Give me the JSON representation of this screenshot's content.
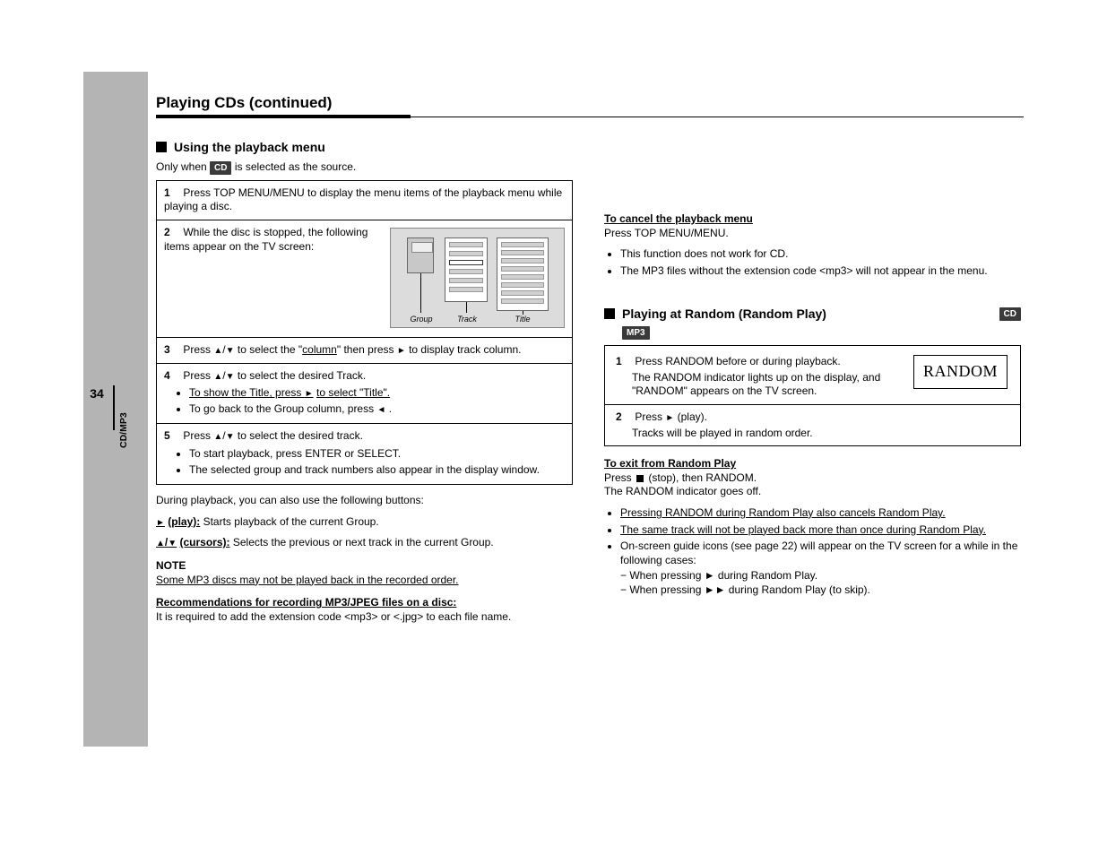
{
  "page_number": "34",
  "section_label": "CD/MP3",
  "chapter_title": "Playing CDs (continued)",
  "left": {
    "heading": "Using the playback menu",
    "badge": "CD",
    "intro_before_badge": "Only when ",
    "intro_after_badge": " is selected as the source.",
    "table": {
      "row1": {
        "text": "Press TOP MENU/MENU to display the menu items of the playback menu while playing a disc."
      },
      "row2": {
        "text_before": "While the disc is stopped, the following items appear on the TV screen:",
        "diagram": {
          "a": "Group",
          "b": "Track",
          "c": "Title"
        }
      },
      "row3": {
        "prefix": "Press ",
        "mid1": " to select the \"",
        "col_phrase": "column",
        "mid2": "\" then press ",
        "suffix": " to display track column."
      },
      "row4": {
        "prefix": "Press ",
        "mid": " to select the desired Track.",
        "b1_prefix": "To show the Title, press ",
        "b1_suffix": " to select \"Title\".",
        "b2_prefix": "To go back to the Group column, press ",
        "b2_suffix": "."
      },
      "row5": {
        "prefix": "Press ",
        "mid": " to select the desired track.",
        "b1": "To start playback, press ENTER or SELECT.",
        "b2": "The selected group and track numbers also appear in the display window."
      }
    },
    "after": {
      "line1": "During playback, you can also use the following buttons:",
      "h1_before": "",
      "h1_after": " (play):",
      "h1_body": "Starts playback of the current Group.",
      "h2_before": "",
      "h2_after": " (cursors):",
      "h2_body": "Selects the previous or next track in the current Group.",
      "note_head": "NOTE",
      "note_line_before": "Some MP3 discs may not be played back in the recorded order.",
      "lim_head": "Recommendations for recording MP3/JPEG files on a disc:",
      "lim_body": "It is required to add the extension code <mp3> or <.jpg> to each file name."
    }
  },
  "right": {
    "cancel_head": "To cancel the playback menu",
    "cancel_body": "Press TOP MENU/MENU.",
    "b1": "This function does not work for CD.",
    "b2": "The MP3 files without the extension code <mp3> will not appear in the menu.",
    "heading": "Playing at Random (Random Play)",
    "badge1": "CD",
    "badge2": "MP3",
    "random": {
      "row1_prefix": "Press RANDOM before or during playback.",
      "row1_body": "The RANDOM indicator lights up on the display, and \"RANDOM\" appears on the TV screen.",
      "display": "RANDOM",
      "row2_prefix": "Press ",
      "row2_suffix": " (play).",
      "row2_body": "Tracks will be played in random order."
    },
    "exit_head": "To exit from Random Play",
    "exit_body_before": "Press ",
    "exit_body_after": " (stop), then RANDOM.",
    "exit_body2": "The RANDOM indicator goes off.",
    "b_a": "Pressing RANDOM during Random Play also cancels Random Play.",
    "b_b": "The same track will not be played back more than once during Random Play.",
    "b_c": "On-screen guide icons (see page 22) will appear on the TV screen for a while in the following cases:",
    "b_c1": "− When pressing ► during Random Play.",
    "b_c2": "− When pressing ►► during Random Play (to skip)."
  }
}
